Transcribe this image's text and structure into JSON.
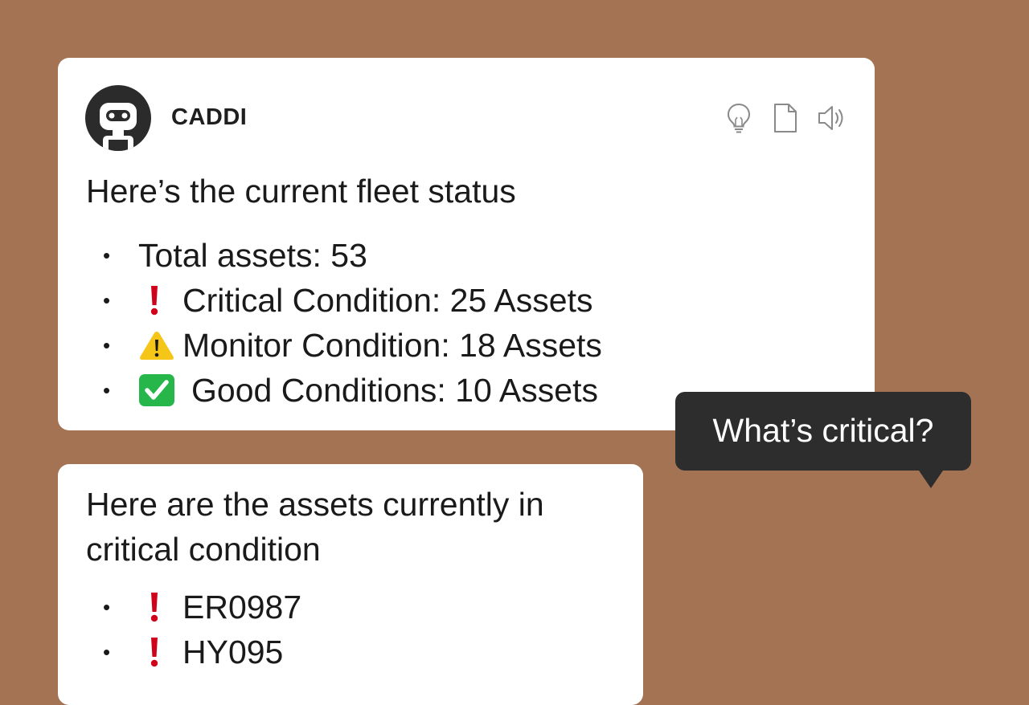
{
  "assistant": {
    "name": "CADDI",
    "avatar_icon": "robot-icon",
    "tools": [
      {
        "icon": "lightbulb-icon"
      },
      {
        "icon": "document-icon"
      },
      {
        "icon": "speaker-icon"
      }
    ]
  },
  "status_message": {
    "title": "Here’s the current fleet status",
    "items": [
      {
        "icon": "",
        "text": "Total assets: 53"
      },
      {
        "icon": "exclamation-icon",
        "text": "Critical Condition: 25 Assets"
      },
      {
        "icon": "warning-icon",
        "text": "Monitor Condition: 18 Assets"
      },
      {
        "icon": "check-icon",
        "text": "Good Conditions: 10 Assets"
      }
    ]
  },
  "user_message": {
    "text": "What’s critical?"
  },
  "critical_message": {
    "title": "Here are the assets currently in critical condition",
    "items": [
      {
        "icon": "exclamation-icon",
        "text": "ER0987"
      },
      {
        "icon": "exclamation-icon",
        "text": "HY095"
      }
    ]
  },
  "colors": {
    "background": "#a47354",
    "card": "#ffffff",
    "tooltip": "#2d2d2d",
    "critical": "#d0021b",
    "warning": "#f5c518",
    "good": "#26b64a"
  }
}
